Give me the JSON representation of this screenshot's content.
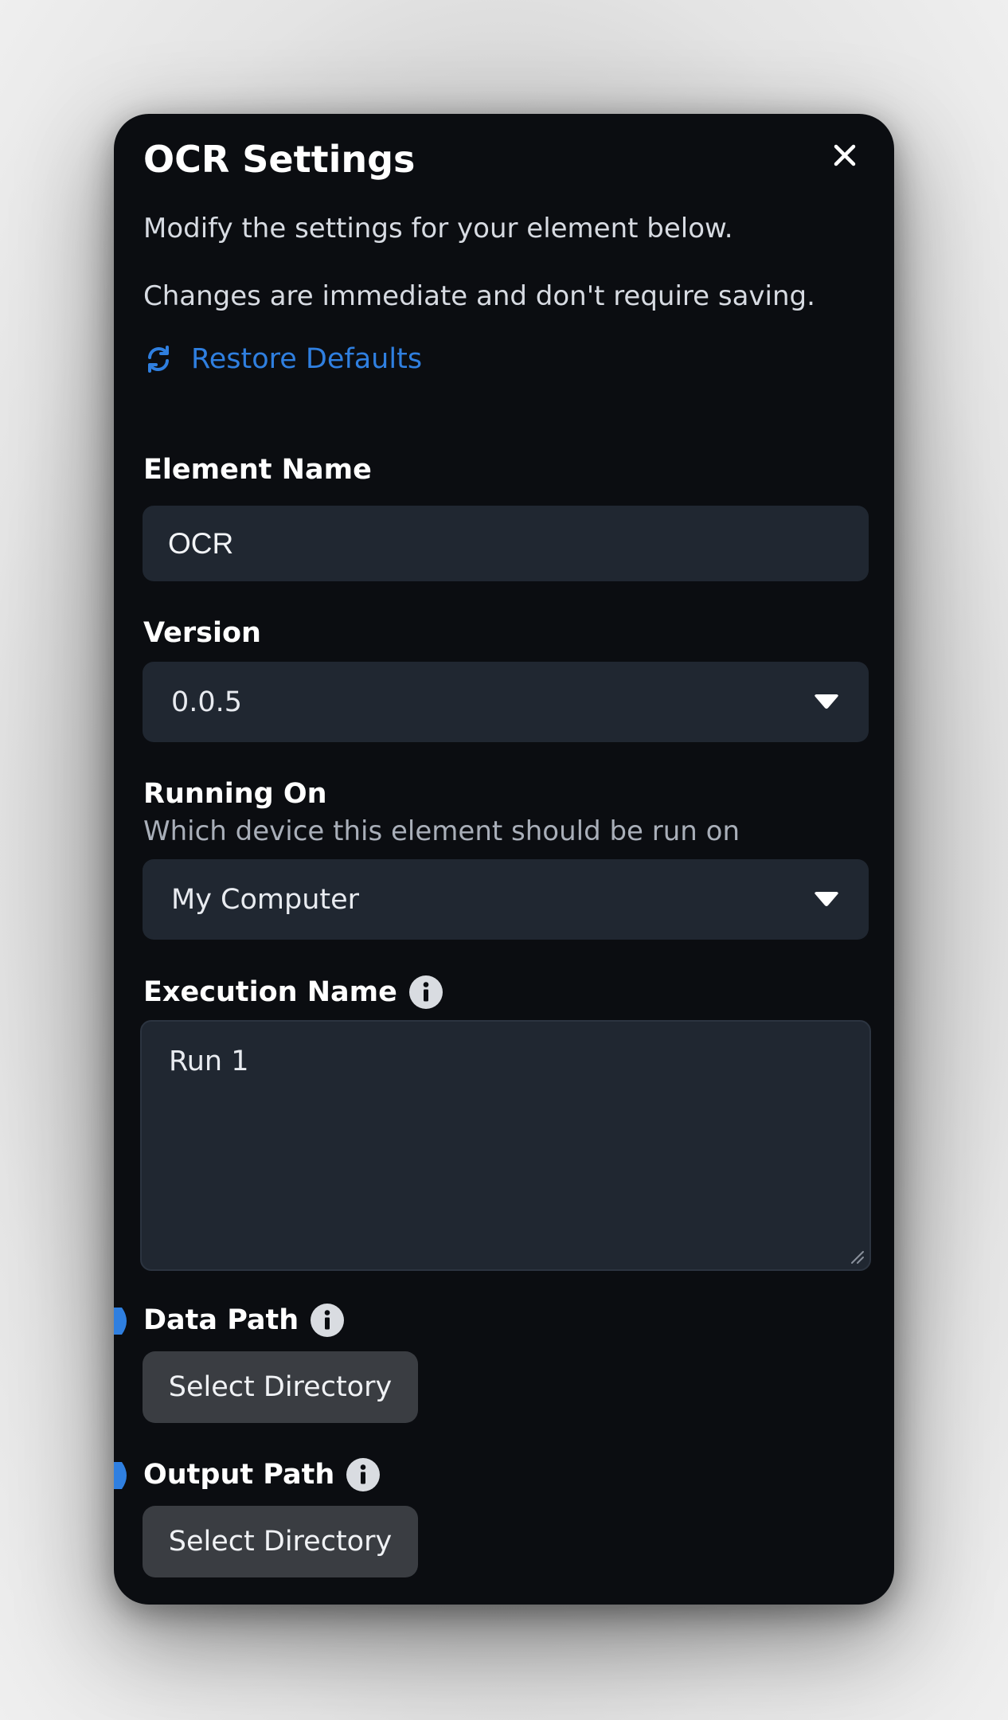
{
  "dialog": {
    "title": "OCR Settings",
    "description_line1": "Modify the settings for your element below.",
    "description_line2": "Changes are immediate and don't require saving.",
    "restore_defaults_label": "Restore Defaults",
    "accent_color": "#2f7fe0"
  },
  "fields": {
    "element_name": {
      "label": "Element Name",
      "value": "OCR"
    },
    "version": {
      "label": "Version",
      "selected": "0.0.5"
    },
    "running_on": {
      "label": "Running On",
      "help_text": "Which device this element should be run on",
      "selected": "My Computer"
    },
    "execution_name": {
      "label": "Execution Name",
      "value": "Run 1"
    },
    "data_path": {
      "label": "Data Path",
      "button_label": "Select Directory"
    },
    "output_path": {
      "label": "Output Path",
      "button_label": "Select Directory"
    }
  },
  "icons": {
    "close": "close-icon",
    "restore": "refresh-icon",
    "dropdown": "caret-down-icon",
    "info": "info-icon",
    "input_marker": "connector-marker-icon"
  }
}
